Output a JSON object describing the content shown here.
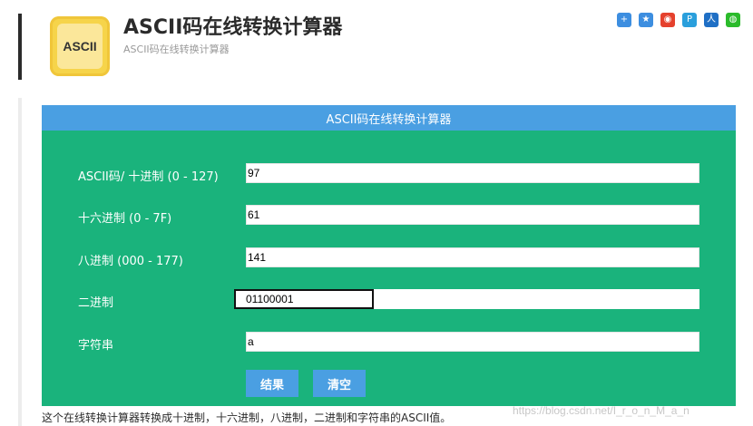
{
  "header": {
    "icon_text": "ASCII",
    "title": "ASCII码在线转换计算器",
    "subtitle": "ASCII码在线转换计算器"
  },
  "share_icons": [
    {
      "name": "add-share-icon",
      "glyph": "+",
      "color": "#3d8ee0"
    },
    {
      "name": "qzone-share-icon",
      "glyph": "★",
      "color": "#3d8ee0"
    },
    {
      "name": "weibo-share-icon",
      "glyph": "◉",
      "color": "#e5412d"
    },
    {
      "name": "tencent-weibo-share-icon",
      "glyph": "P",
      "color": "#2a9fdc"
    },
    {
      "name": "renren-share-icon",
      "glyph": "人",
      "color": "#1f6fc5"
    },
    {
      "name": "wechat-share-icon",
      "glyph": "◍",
      "color": "#2bbb2b"
    }
  ],
  "panel": {
    "title": "ASCII码在线转换计算器",
    "rows": [
      {
        "label": "ASCII码/ 十进制 (0 - 127)",
        "value": "97"
      },
      {
        "label": "十六进制 (0 - 7F)",
        "value": "61"
      },
      {
        "label": "八进制 (000 - 177)",
        "value": "141"
      },
      {
        "label": "二进制",
        "value": "01100001"
      },
      {
        "label": "字符串",
        "value": "a"
      }
    ],
    "result_label": "结果",
    "clear_label": "清空"
  },
  "description": "这个在线转换计算器转换成十进制，十六进制，八进制，二进制和字符串的ASCII值。",
  "watermark": "https://blog.csdn.net/I_r_o_n_M_a_n",
  "colors": {
    "panel": "#1ab37c",
    "header": "#4a9fe2",
    "button": "#4a9fe2"
  }
}
